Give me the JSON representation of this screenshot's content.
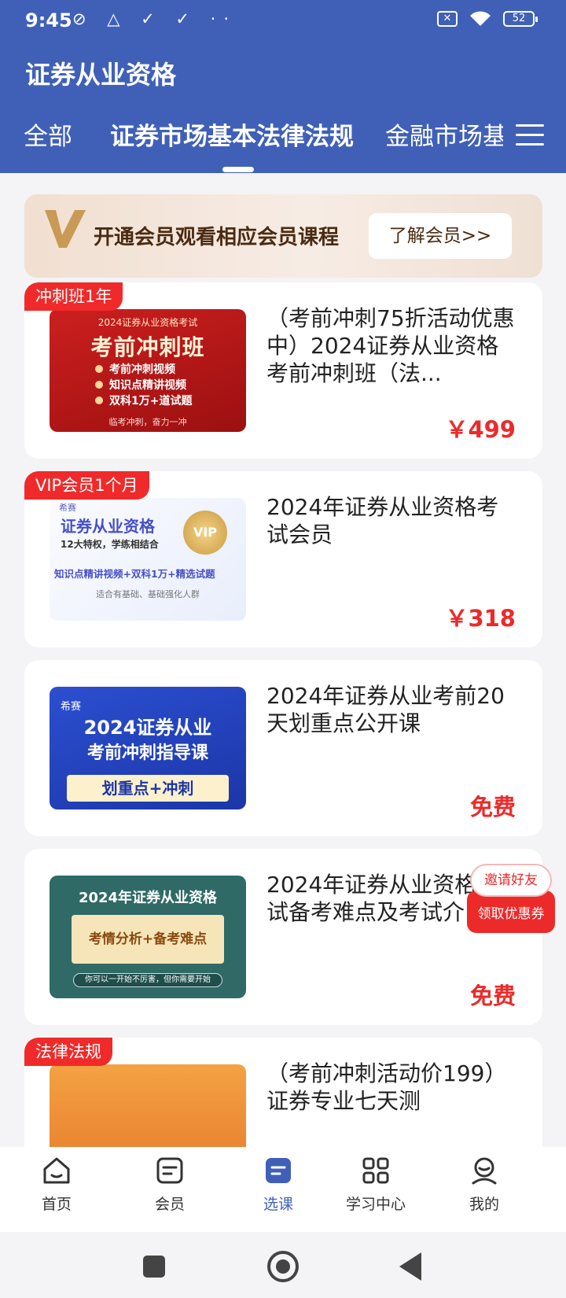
{
  "status_bar": {
    "time": "9:45",
    "left_icons": "⊘ △ ✓ ✓ ··",
    "x_label": "✕",
    "battery": "52"
  },
  "header": {
    "title": "证券从业资格"
  },
  "tabs": [
    {
      "label": "全部"
    },
    {
      "label": "证券市场基本法律法规",
      "active": true
    },
    {
      "label": "金融市场基"
    }
  ],
  "vip_banner": {
    "text": "开通会员观看相应会员课程",
    "button": "了解会员>>",
    "logo": "V"
  },
  "courses": [
    {
      "tag": "冲刺班1年",
      "title": "（考前冲刺75折活动优惠中）2024证券从业资格考前冲刺班（法...",
      "price": "￥499",
      "thumb": {
        "line1": "2024证券从业资格考试",
        "line2": "考前冲刺班",
        "b1": "考前冲刺视频",
        "b2": "知识点精讲视频",
        "b3": "双科1万+道试题",
        "foot": "临考冲刺，奋力一冲"
      }
    },
    {
      "tag": "VIP会员1个月",
      "title": "2024年证券从业资格考试会员",
      "price": "￥318",
      "thumb": {
        "brand": "希赛",
        "line1": "证券从业资格",
        "line2": "12大特权，学练相结合",
        "badge": "VIP",
        "line3": "知识点精讲视频+双科1万+精选试题",
        "foot": "适合有基础、基础强化人群"
      }
    },
    {
      "tag": "",
      "title": "2024年证券从业考前20天划重点公开课",
      "price": "免费",
      "thumb": {
        "brand": "希赛",
        "line1": "2024证券从业",
        "line2": "考前冲刺指导课",
        "line3": "划重点+冲刺"
      }
    },
    {
      "tag": "",
      "title": "2024年证券从业资格考试备考难点及考试介",
      "price": "免费",
      "thumb": {
        "line1": "2024年证券从业资格",
        "line2": "考情分析+备考难点",
        "foot": "你可以一开始不厉害，但你需要开始"
      }
    },
    {
      "tag": "法律法规",
      "title": "（考前冲刺活动价199）证券专业七天测",
      "price": ""
    }
  ],
  "invite": {
    "top": "邀请好友",
    "bottom": "领取优惠券"
  },
  "bottom_nav": [
    {
      "label": "首页",
      "icon": "home-icon"
    },
    {
      "label": "会员",
      "icon": "member-icon"
    },
    {
      "label": "选课",
      "icon": "course-icon",
      "active": true
    },
    {
      "label": "学习中心",
      "icon": "study-center-icon"
    },
    {
      "label": "我的",
      "icon": "profile-icon"
    }
  ],
  "colors": {
    "primary": "#4060b8",
    "accent": "#ec2a2a",
    "tag": "#f02a2a"
  }
}
